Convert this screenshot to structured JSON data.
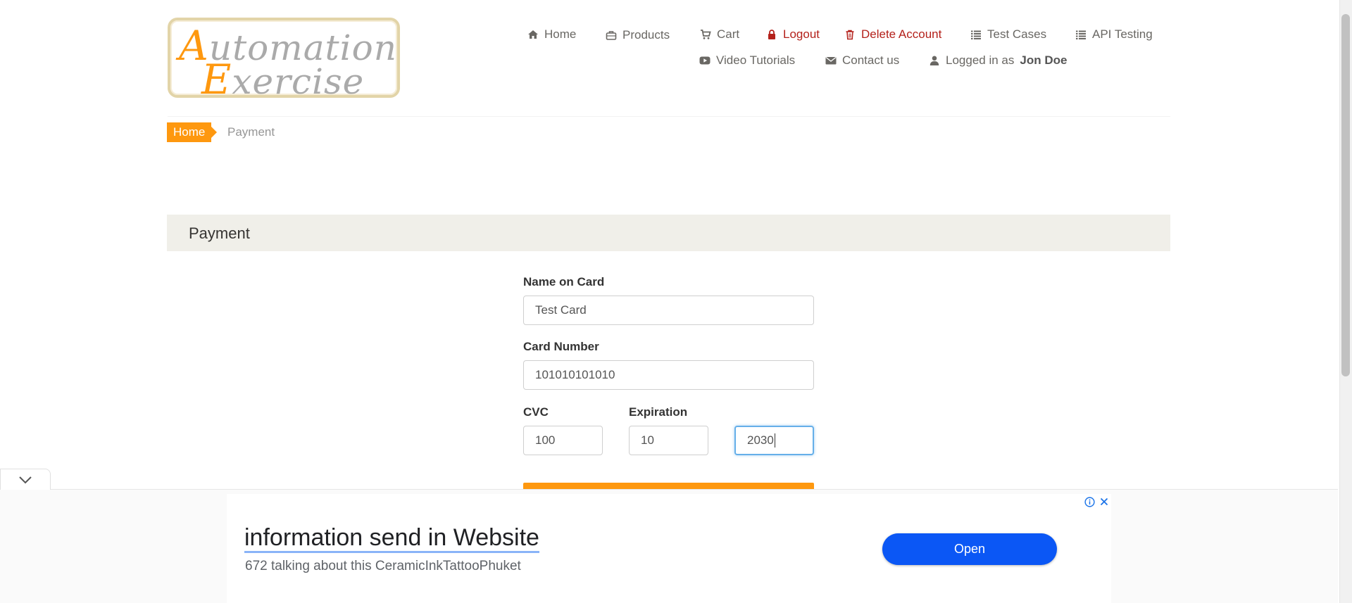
{
  "logo": {
    "line1_cap": "A",
    "line1_rest": "utomation",
    "line2_cap": "E",
    "line2_rest": "xercise"
  },
  "nav": {
    "home": "Home",
    "products": "Products",
    "cart": "Cart",
    "logout": "Logout",
    "delete_account": "Delete Account",
    "test_cases": "Test Cases",
    "api_testing": "API Testing",
    "video_tutorials": "Video Tutorials",
    "contact_us": "Contact us",
    "logged_in_prefix": "Logged in as",
    "username": "Jon Doe"
  },
  "breadcrumb": {
    "home": "Home",
    "current": "Payment"
  },
  "section_title": "Payment",
  "form": {
    "name_label": "Name on Card",
    "name_value": "Test Card",
    "card_label": "Card Number",
    "card_value": "101010101010",
    "cvc_label": "CVC",
    "cvc_value": "100",
    "expiration_label": "Expiration",
    "exp_month_value": "10",
    "exp_year_value": "2030"
  },
  "ad": {
    "title": "information send in Website",
    "subtitle": "672 talking about this CeramicInkTattooPhuket",
    "button": "Open"
  },
  "colors": {
    "accent": "#fe980f",
    "danger": "#b4211b",
    "ad_button": "#0b57f5"
  }
}
